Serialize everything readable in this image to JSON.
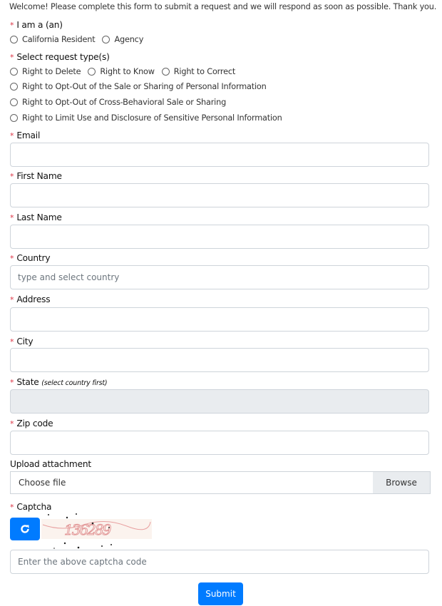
{
  "intro": "Welcome! Please complete this form to submit a request and we will respond as soon as possible. Thank you.",
  "iam": {
    "label": "I am a (an)",
    "options": [
      "California Resident",
      "Agency"
    ]
  },
  "request": {
    "label": "Select request type(s)",
    "options": [
      "Right to Delete",
      "Right to Know",
      "Right to Correct",
      "Right to Opt-Out of the Sale or Sharing of Personal Information",
      "Right to Opt-Out of Cross-Behavioral Sale or Sharing",
      "Right to Limit Use and Disclosure of Sensitive Personal Information"
    ]
  },
  "fields": {
    "email": {
      "label": "Email",
      "value": ""
    },
    "first": {
      "label": "First Name",
      "value": ""
    },
    "last": {
      "label": "Last Name",
      "value": ""
    },
    "country": {
      "label": "Country",
      "placeholder": "type and select country"
    },
    "address": {
      "label": "Address",
      "value": ""
    },
    "city": {
      "label": "City",
      "value": ""
    },
    "state": {
      "label": "State",
      "hint": "(select country first)"
    },
    "zip": {
      "label": "Zip code",
      "value": ""
    }
  },
  "upload": {
    "label": "Upload attachment",
    "choose": "Choose file",
    "browse": "Browse"
  },
  "captcha": {
    "label": "Captcha",
    "image_text": "136289",
    "placeholder": "Enter the above captcha code"
  },
  "submit": "Submit",
  "colors": {
    "primary": "#007bff",
    "required": "#dc3545"
  }
}
